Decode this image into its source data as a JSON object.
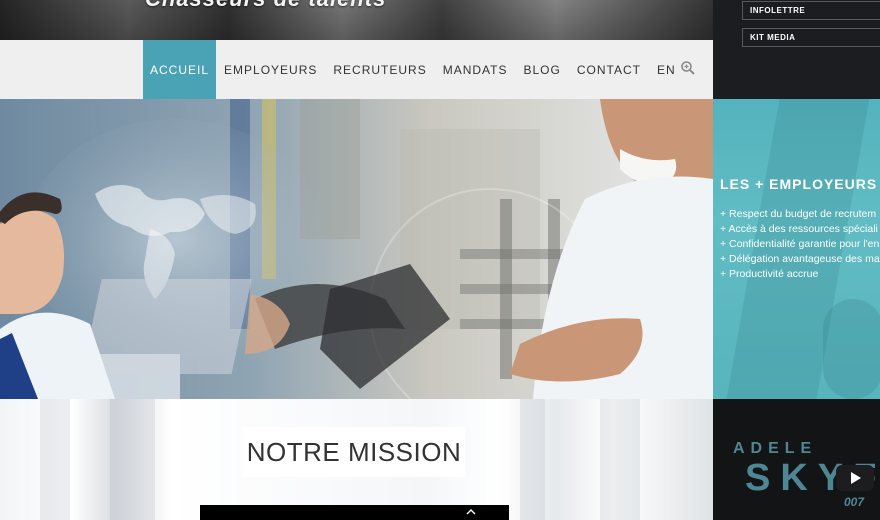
{
  "header": {
    "tagline": "Chasseurs de talents"
  },
  "nav": {
    "items": [
      {
        "label": "ACCUEIL",
        "active": true
      },
      {
        "label": "EMPLOYEURS",
        "active": false
      },
      {
        "label": "RECRUTEURS",
        "active": false
      },
      {
        "label": "MANDATS",
        "active": false
      },
      {
        "label": "BLOG",
        "active": false
      },
      {
        "label": "CONTACT",
        "active": false
      },
      {
        "label": "EN",
        "active": false
      }
    ],
    "search_icon": "search-icon",
    "active_color": "#4aa3b5"
  },
  "sidebar": {
    "links": [
      "INFOLETTRE",
      "KIT MEDIA"
    ]
  },
  "promo": {
    "title": "LES + EMPLOYEURS",
    "items": [
      "+ Respect du budget de recrutem",
      "+ Accès à des ressources spéciali",
      "+ Confidentialité garantie pour l'en",
      "+ Délégation avantageuse des ma",
      "+ Productivité accrue"
    ],
    "color": "#5ab6bf"
  },
  "mission": {
    "title": "NOTRE MISSION"
  },
  "video": {
    "line1": "ADELE",
    "line2": "SKYF",
    "line3": "007",
    "play_icon": "play-icon"
  }
}
